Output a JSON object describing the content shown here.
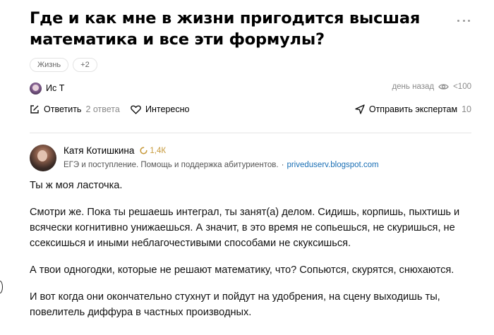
{
  "question": {
    "title": "Где и как мне в жизни пригодится высшая математика и все эти формулы?",
    "tags": [
      "Жизнь",
      "+2"
    ],
    "author": "Ис Т",
    "time": "день назад",
    "views": "<100",
    "actions": {
      "answer_label": "Ответить",
      "answer_count": "2 ответа",
      "interesting_label": "Интересно",
      "send_label": "Отправить экспертам",
      "send_count": "10"
    }
  },
  "answer": {
    "author_name": "Катя Котишкина",
    "rating": "1,4К",
    "bio": "ЕГЭ и поступление. Помощь и поддержка абитуриентов.",
    "separator": "·",
    "link": "priveduserv.blogspot.com",
    "paragraphs": [
      "Ты ж моя ласточка.",
      "Смотри же. Пока ты решаешь интеграл, ты занят(а) делом. Сидишь, корпишь, пыхтишь и всячески когнитивно унижаешься. А значит, в это время не сопьешься, не скуришься, не ссексишься и иными неблагочестивыми способами не скуксишься.",
      "А твои одногодки, которые не решают математику, что? Сопьются, скурятся, снюхаются.",
      "И вот когда они окончательно стухнут и пойдут на удобрения, на сцену выходишь ты, повелитель диффура в частных производных."
    ]
  },
  "colors": {
    "accent_link": "#1a6fb5",
    "rating": "#c79a3c",
    "muted": "#8a8a8a"
  },
  "icons": [
    "more-dots-icon",
    "eye-icon",
    "pencil-edit-icon",
    "heart-icon",
    "send-plane-icon",
    "rating-ring-icon"
  ]
}
